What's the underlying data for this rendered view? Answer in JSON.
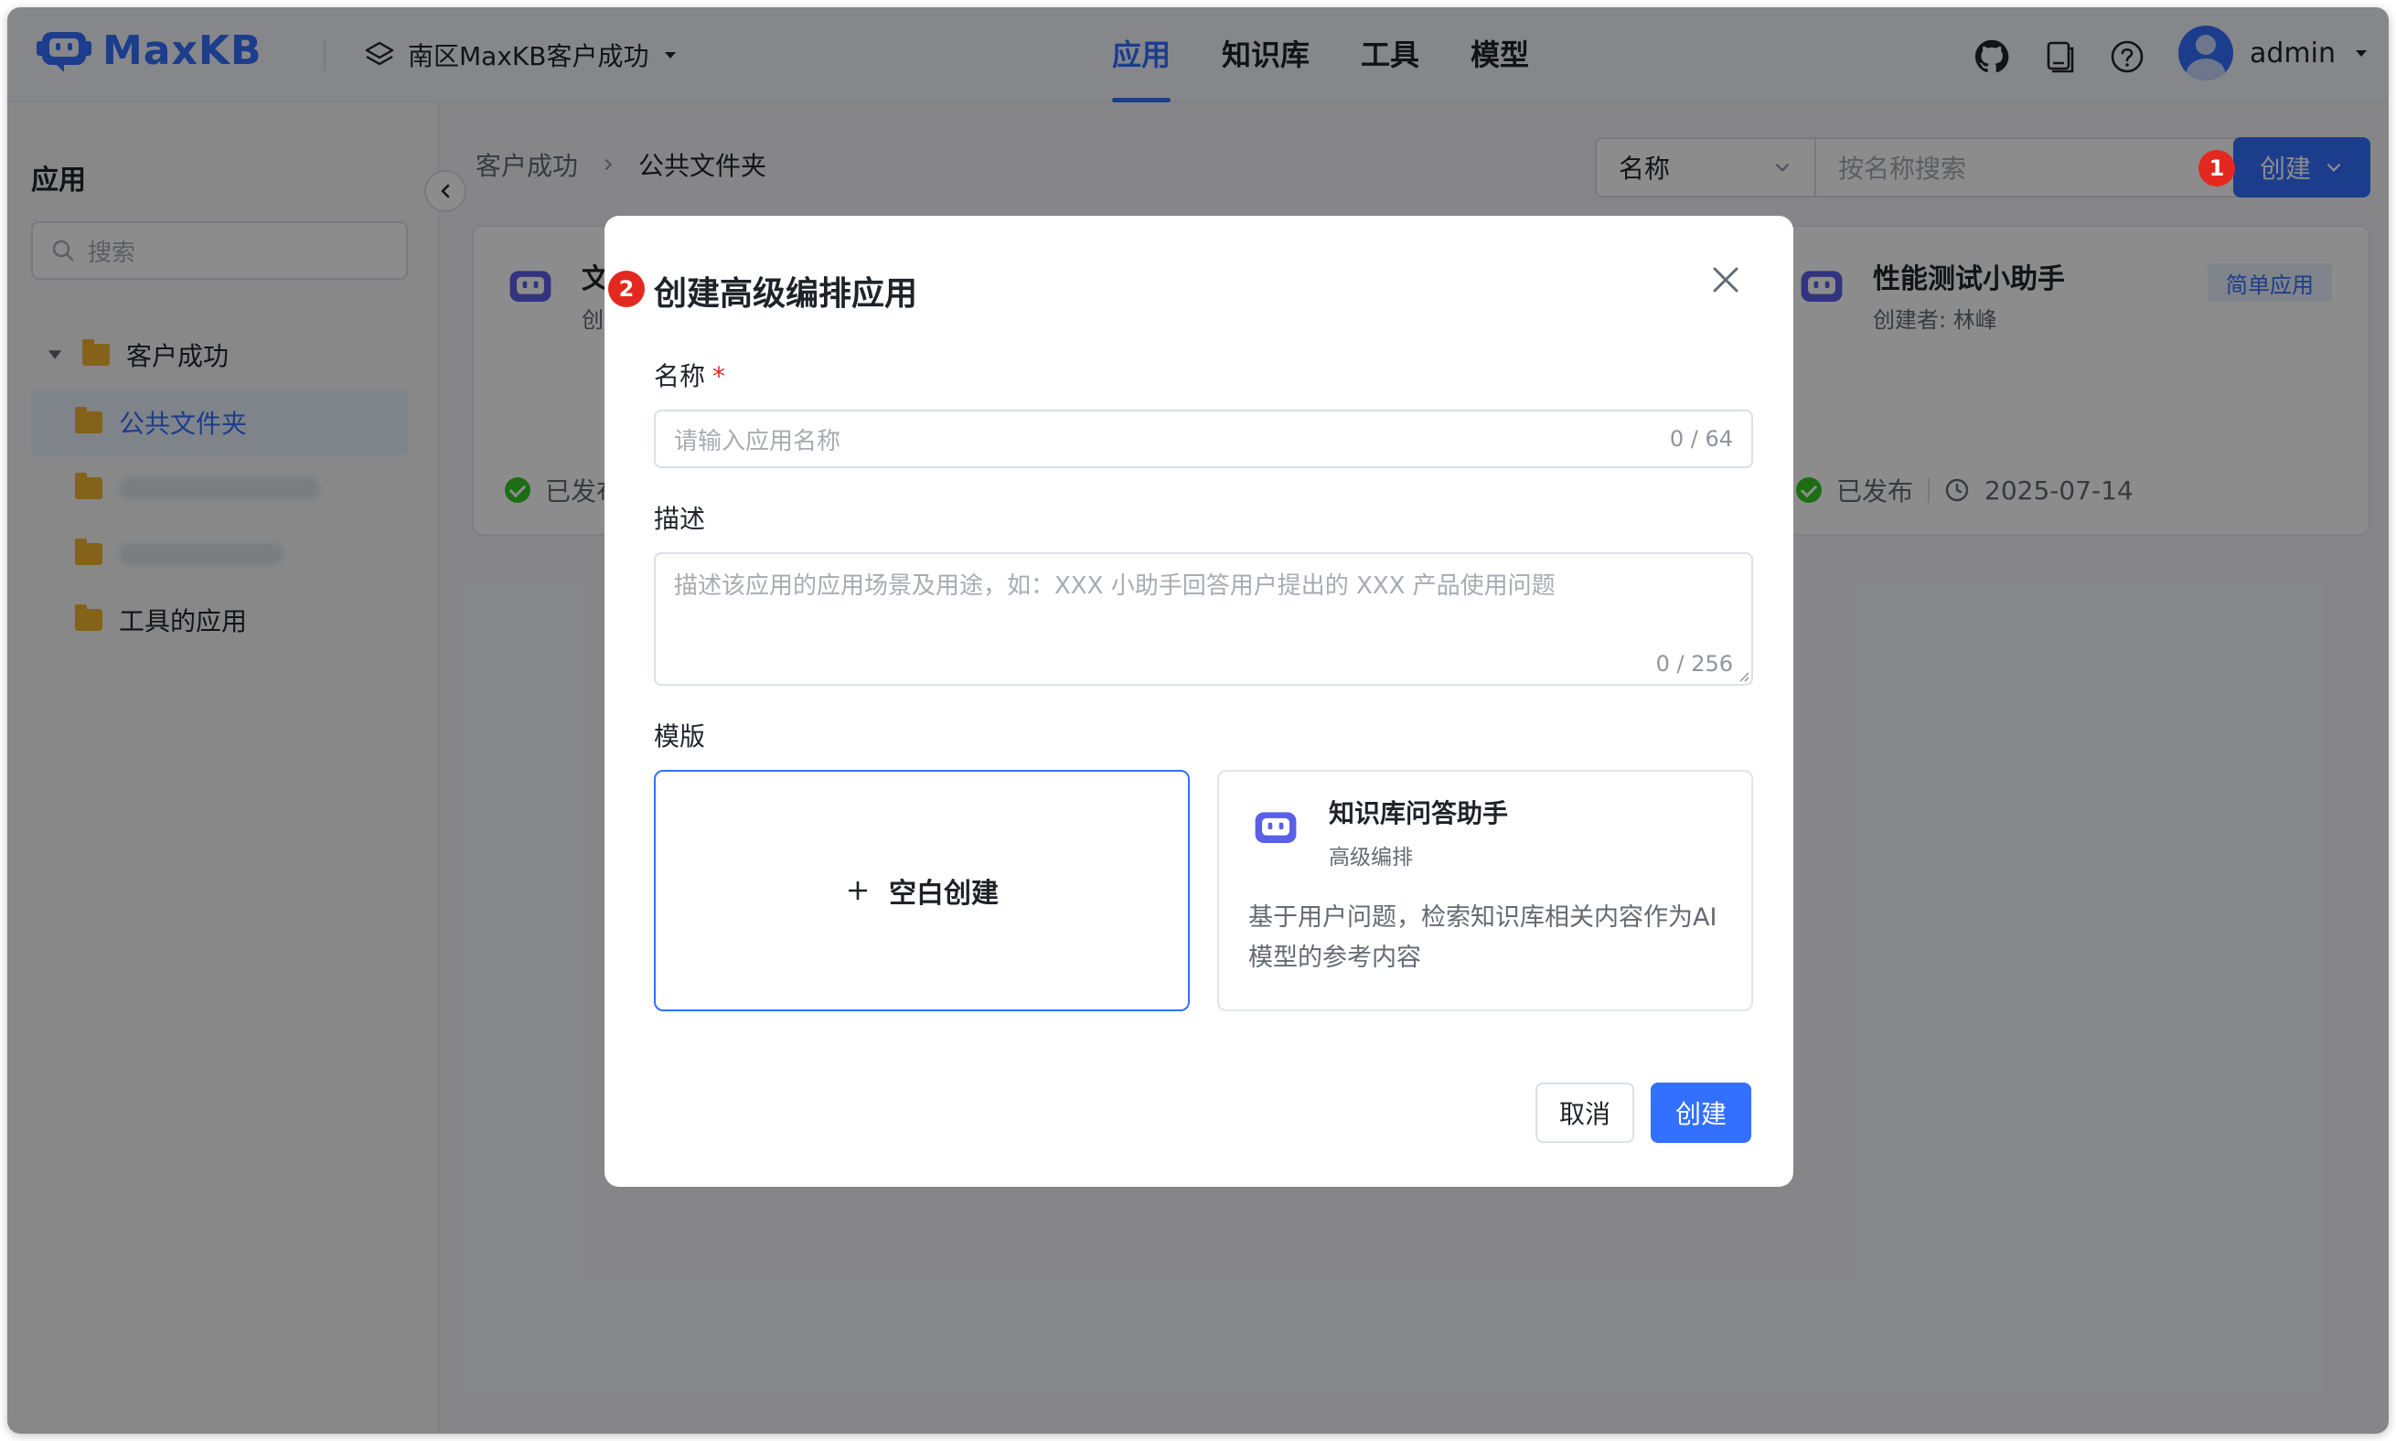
{
  "header": {
    "logo_text": "MaxKB",
    "workspace": "南区MaxKB客户成功",
    "nav": [
      {
        "label": "应用",
        "active": true
      },
      {
        "label": "知识库",
        "active": false
      },
      {
        "label": "工具",
        "active": false
      },
      {
        "label": "模型",
        "active": false
      }
    ],
    "icons": [
      "github-icon",
      "document-icon",
      "help-icon"
    ],
    "username": "admin"
  },
  "sidebar": {
    "title": "应用",
    "search_placeholder": "搜索",
    "root_folder": "客户成功",
    "folders": [
      {
        "label": "公共文件夹",
        "active": true
      },
      {
        "label": "",
        "blurred": true
      },
      {
        "label": "",
        "blurred": true
      },
      {
        "label": "工具的应用",
        "active": false
      }
    ]
  },
  "main": {
    "breadcrumb": [
      "客户成功",
      "公共文件夹"
    ],
    "filter_select": "名称",
    "search_placeholder": "按名称搜索",
    "create_label": "创建",
    "cards": [
      {
        "title_fragment": "文",
        "sub_fragment": "创",
        "status_fragment": "已发布"
      },
      {
        "title": "性能测试小助手",
        "creator": "创建者: 林峰",
        "tag": "简单应用",
        "status": "已发布",
        "date": "2025-07-14"
      }
    ]
  },
  "annotations": {
    "badge1": "1",
    "badge2": "2"
  },
  "dialog": {
    "title": "创建高级编排应用",
    "name_label": "名称",
    "required_mark": "*",
    "name_placeholder": "请输入应用名称",
    "name_count": "0 / 64",
    "desc_label": "描述",
    "desc_placeholder": "描述该应用的应用场景及用途，如：XXX 小助手回答用户提出的 XXX 产品使用问题",
    "desc_count": "0 / 256",
    "template_label": "模版",
    "template_blank": "空白创建",
    "template_kb": {
      "title": "知识库问答助手",
      "subtitle": "高级编排",
      "description": "基于用户问题，检索知识库相关内容作为AI模型的参考内容"
    },
    "cancel_label": "取消",
    "ok_label": "创建"
  },
  "colors": {
    "primary": "#3370ff",
    "badge": "#e3291f",
    "success": "#34c724",
    "folder": "#f0b32e"
  }
}
